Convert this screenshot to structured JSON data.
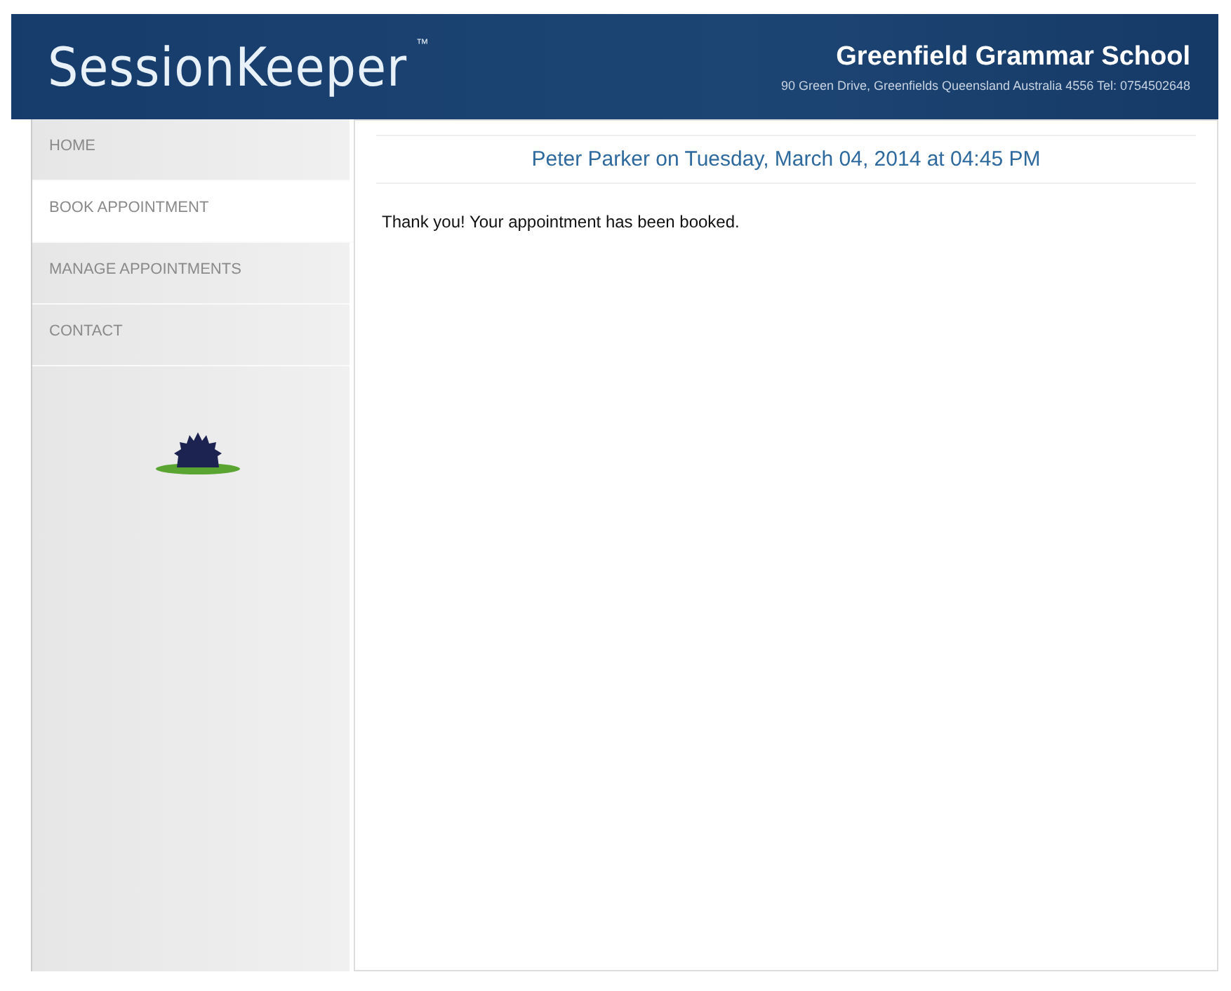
{
  "header": {
    "logo": "SessionKeeper",
    "trademark": "™",
    "school_name": "Greenfield Grammar School",
    "school_address": "90 Green Drive, Greenfields Queensland Australia 4556 Tel: 0754502648"
  },
  "sidebar": {
    "items": [
      {
        "label": "HOME",
        "selected": false
      },
      {
        "label": "BOOK APPOINTMENT",
        "selected": true
      },
      {
        "label": "MANAGE APPOINTMENTS",
        "selected": false
      },
      {
        "label": "CONTACT",
        "selected": false
      }
    ]
  },
  "content": {
    "heading": "Peter Parker on Tuesday, March 04, 2014 at 04:45 PM",
    "message": "Thank you! Your appointment has been booked."
  }
}
